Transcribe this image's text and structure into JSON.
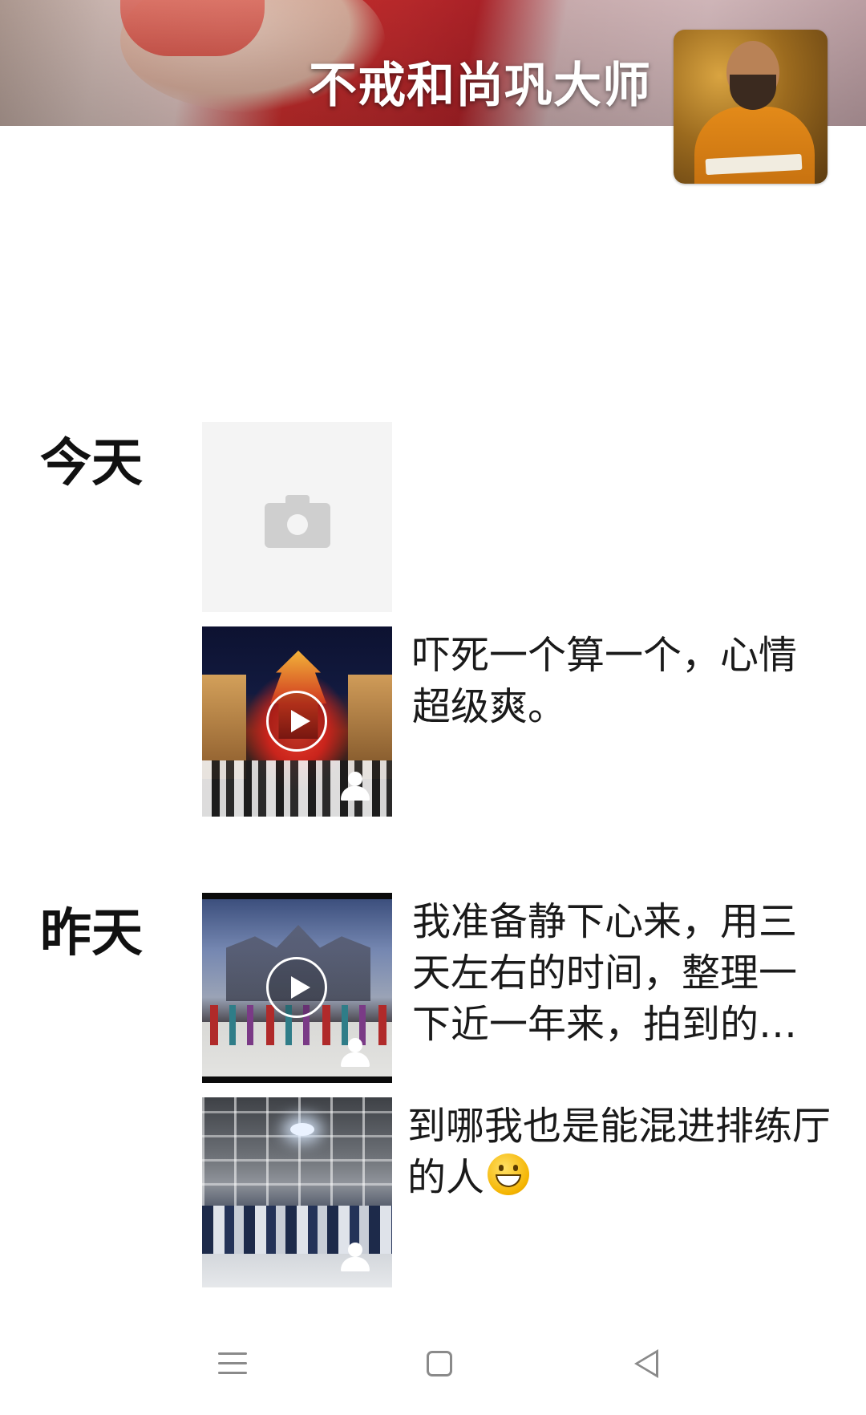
{
  "profile": {
    "name": "不戒和尚巩大师"
  },
  "timeline": [
    {
      "date_label": "今天",
      "posts": [
        {
          "type": "photo-placeholder",
          "icon": "camera-icon"
        },
        {
          "type": "video",
          "text": "吓死一个算一个，心情超级爽。",
          "icon": "play-icon",
          "badge_icon": "user-icon"
        }
      ]
    },
    {
      "date_label": "昨天",
      "posts": [
        {
          "type": "video",
          "text": "我准备静下心来，用三天左右的时间，整理一下近一年来，拍到的…",
          "icon": "play-icon",
          "badge_icon": "user-icon"
        },
        {
          "type": "photo",
          "text": "到哪我也是能混进排练厅的人",
          "emoji_icon": "grin-emoji-icon",
          "badge_icon": "user-icon"
        }
      ]
    }
  ],
  "navbar": {
    "menu_icon": "menu-icon",
    "home_icon": "home-icon",
    "back_icon": "back-icon"
  }
}
